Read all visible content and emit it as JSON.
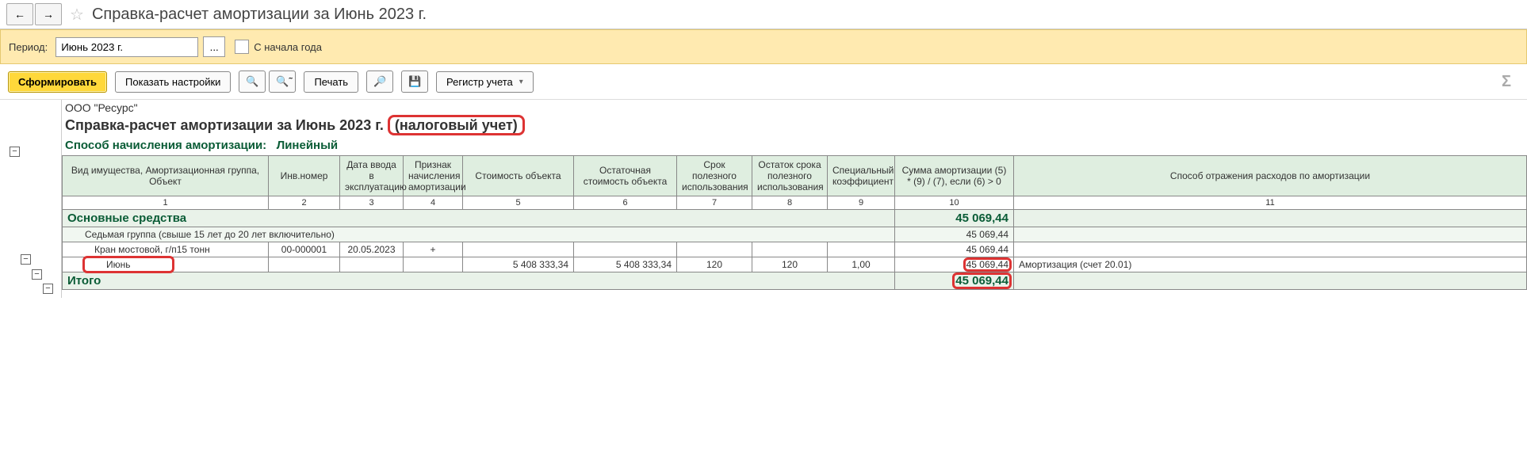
{
  "topbar": {
    "title": "Справка-расчет амортизации за Июнь 2023 г."
  },
  "period": {
    "label": "Период:",
    "value": "Июнь 2023 г.",
    "more": "...",
    "from_start_label": "С начала года"
  },
  "toolbar": {
    "form": "Сформировать",
    "settings": "Показать настройки",
    "print": "Печать",
    "register": "Регистр учета"
  },
  "report": {
    "org": "ООО \"Ресурс\"",
    "title_main": "Справка-расчет амортизации за Июнь 2023 г.",
    "title_suffix": "(налоговый учет)",
    "method_label": "Способ начисления амортизации:",
    "method_value": "Линейный",
    "headers": {
      "c1": "Вид имущества,\nАмортизационная группа,\nОбъект",
      "c2": "Инв.номер",
      "c3": "Дата ввода в эксплуатацию",
      "c4": "Признак начисления амортизации",
      "c5": "Стоимость объекта",
      "c6": "Остаточная стоимость объекта",
      "c7": "Срок полезного использования",
      "c8": "Остаток срока полезного использования",
      "c9": "Специальный коэффициент",
      "c10": "Сумма амортизации\n(5) * (9) / (7),\nесли (6) > 0",
      "c11": "Способ отражения расходов по амортизации"
    },
    "nums": {
      "n1": "1",
      "n2": "2",
      "n3": "3",
      "n4": "4",
      "n5": "5",
      "n6": "6",
      "n7": "7",
      "n8": "8",
      "n9": "9",
      "n10": "10",
      "n11": "11"
    },
    "section": {
      "name": "Основные средства",
      "sum": "45 069,44"
    },
    "group": {
      "name": "Седьмая группа (свыше 15 лет до 20 лет включительно)",
      "sum": "45 069,44"
    },
    "object": {
      "name": "Кран мостовой, г/п15 тонн",
      "inv": "00-000001",
      "date": "20.05.2023",
      "flag": "+",
      "sum": "45 069,44"
    },
    "month": {
      "name": "Июнь",
      "cost": "5 408 333,34",
      "residual": "5 408 333,34",
      "term": "120",
      "term_left": "120",
      "coef": "1,00",
      "sum": "45 069,44",
      "expense": "Амортизация (счет 20.01)"
    },
    "total": {
      "label": "Итого",
      "sum": "45 069,44"
    }
  }
}
